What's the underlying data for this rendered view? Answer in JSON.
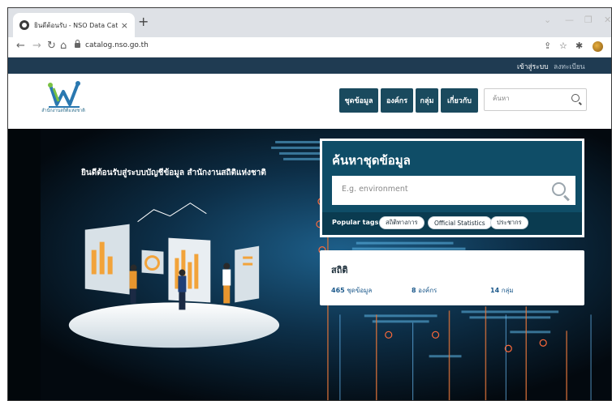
{
  "browser": {
    "tab_title": "ยินดีต้อนรับ - NSO Data Catalog",
    "tab_close": "×",
    "new_tab": "+",
    "url": "catalog.nso.go.th",
    "icons": [
      "back-icon",
      "forward-icon",
      "reload-icon",
      "home-icon",
      "lock-icon",
      "share-icon",
      "star-icon",
      "extensions-icon",
      "profile-avatar",
      "menu-icon"
    ]
  },
  "site_bar": {
    "login": "เข้าสู่ระบบ",
    "register": "ลงทะเบียน"
  },
  "header": {
    "logo_caption": "สำนักงานสถิติแห่งชาติ",
    "nav": [
      "ชุดข้อมูล",
      "องค์กร",
      "กลุ่ม",
      "เกี่ยวกับ"
    ],
    "search_placeholder": "ค้นหา"
  },
  "hero": {
    "welcome": "ยินดีต้อนรับสู่ระบบบัญชีข้อมูล สำนักงานสถิติแห่งชาติ"
  },
  "search_card": {
    "title": "ค้นหาชุดข้อมูล",
    "placeholder": "E.g. environment",
    "tags_label": "Popular tags",
    "tags": [
      "สถิติทางการ",
      "Official Statistics",
      "ประชากร"
    ]
  },
  "stats": {
    "title": "สถิติ",
    "datasets_count": "465",
    "datasets_label": "ชุดข้อมูล",
    "orgs_count": "8",
    "orgs_label": "องค์กร",
    "groups_count": "14",
    "groups_label": "กลุ่ม"
  },
  "colors": {
    "site_bar": "#1f3b52",
    "nav_button": "#1a4a5e",
    "search_card": "#0f4d67",
    "stat_link": "#1d5a8c"
  }
}
